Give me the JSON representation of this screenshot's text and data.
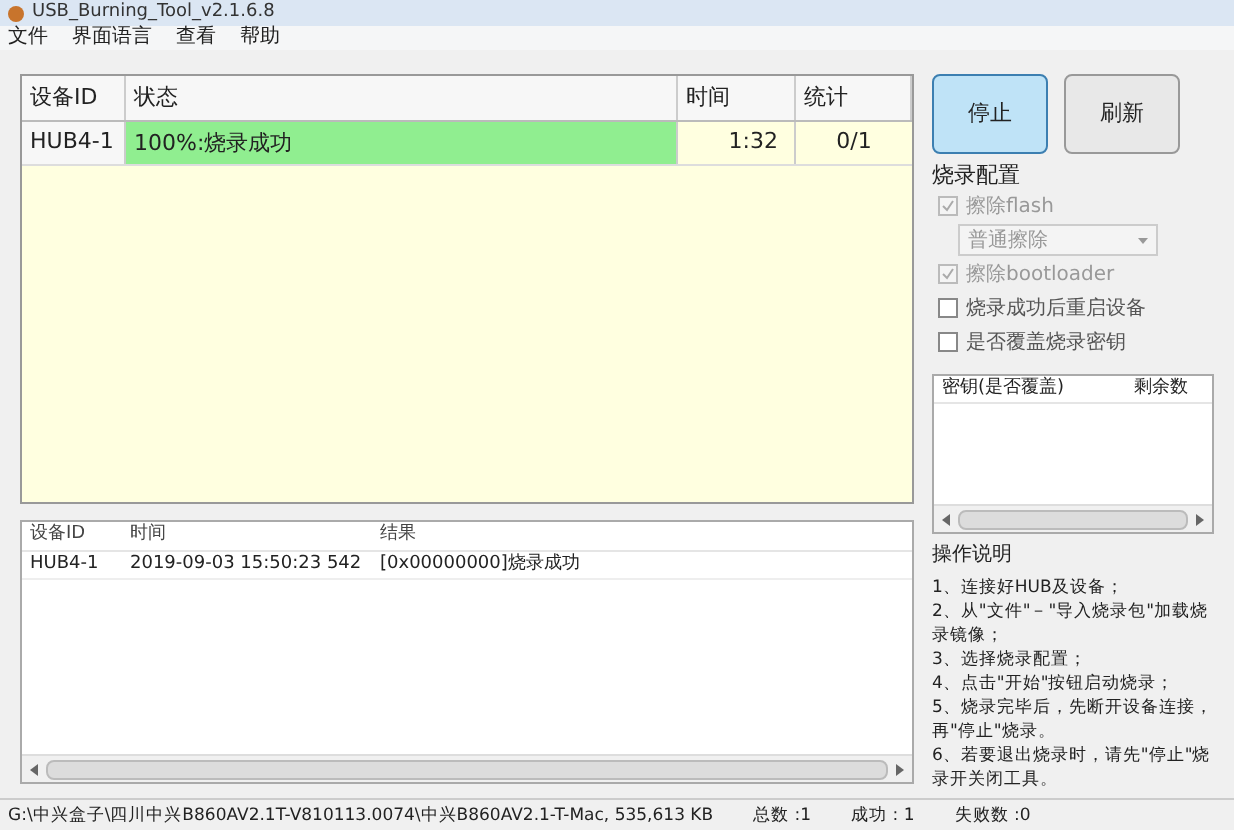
{
  "window": {
    "title": "USB_Burning_Tool_v2.1.6.8"
  },
  "menu": [
    "文件",
    "界面语言",
    "查看",
    "帮助"
  ],
  "device_table": {
    "columns": [
      "设备ID",
      "状态",
      "时间",
      "统计"
    ],
    "rows": [
      {
        "id": "HUB4-1",
        "status": "100%:烧录成功",
        "level": 1,
        "time": "1:32",
        "count": "0/1"
      }
    ]
  },
  "buttons": [
    {
      "label": "停止",
      "selected": true
    },
    {
      "label": "刷新",
      "selected": false
    }
  ],
  "config": {
    "title": "烧录配置",
    "options": [
      {
        "kind": "checkbox",
        "label": "擦除flash",
        "checked": true,
        "disabled": true
      },
      {
        "kind": "select",
        "value": "普通擦除",
        "disabled": true
      },
      {
        "kind": "checkbox",
        "label": "擦除bootloader",
        "checked": true,
        "disabled": true
      },
      {
        "kind": "checkbox",
        "label": "烧录成功后重启设备",
        "checked": false,
        "disabled": false
      },
      {
        "kind": "checkbox",
        "label": "是否覆盖烧录密钥",
        "checked": false,
        "disabled": false
      }
    ]
  },
  "key_table": {
    "columns": [
      "密钥(是否覆盖)",
      "剩余数"
    ]
  },
  "instructions": {
    "title": "操作说明",
    "lines": [
      "1、连接好HUB及设备；",
      "2、从\"文件\"－\"导入烧录包\"加载烧录镜像；",
      "3、选择烧录配置；",
      "4、点击\"开始\"按钮启动烧录；",
      "5、烧录完毕后，先断开设备连接，再\"停止\"烧录。",
      "6、若要退出烧录时，请先\"停止\"烧录开关闭工具。"
    ]
  },
  "log_table": {
    "columns": [
      "设备ID",
      "时间",
      "结果"
    ],
    "rows": [
      {
        "id": "HUB4-1",
        "time": "2019-09-03 15:50:23 542",
        "result": "[0x00000000]烧录成功"
      }
    ]
  },
  "status_bar": {
    "path": "G:\\中兴盒子\\四川中兴B860AV2.1T-V810113.0074\\中兴B860AV2.1-T-Mac, 535,613 KB",
    "total": "总数 :1",
    "success": "成功 : 1",
    "failed": "失败数 :0"
  }
}
